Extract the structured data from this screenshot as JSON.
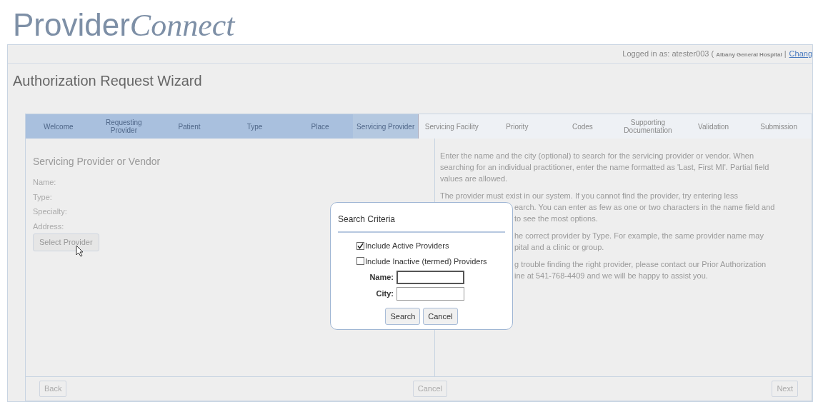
{
  "logo": {
    "part_1": "Provider",
    "part_2": "Connect"
  },
  "header": {
    "logged_in": "Logged in as: atester003 (",
    "organization": "Albany General Hospital",
    "separator": "|",
    "link": "Chang"
  },
  "page_title": "Authorization Request Wizard",
  "steps": [
    {
      "label": "Welcome",
      "completed": true,
      "selected": false
    },
    {
      "label": "Requesting Provider",
      "completed": true,
      "selected": false
    },
    {
      "label": "Patient",
      "completed": true,
      "selected": false
    },
    {
      "label": "Type",
      "completed": true,
      "selected": false
    },
    {
      "label": "Place",
      "completed": true,
      "selected": false
    },
    {
      "label": "Servicing Provider",
      "completed": false,
      "selected": true
    },
    {
      "label": "Servicing Facility",
      "completed": false,
      "selected": false
    },
    {
      "label": "Priority",
      "completed": false,
      "selected": false
    },
    {
      "label": "Codes",
      "completed": false,
      "selected": false
    },
    {
      "label": "Supporting Documentation",
      "completed": false,
      "selected": false
    },
    {
      "label": "Validation",
      "completed": false,
      "selected": false
    },
    {
      "label": "Submission",
      "completed": false,
      "selected": false
    }
  ],
  "left_pane": {
    "heading": "Servicing Provider or Vendor",
    "fields": [
      "Name:",
      "Type:",
      "Specialty:",
      "Address:"
    ],
    "button": "Select Provider"
  },
  "help_paragraphs": [
    {
      "lines": [
        {
          "text": "Enter the name and the city (optional) to search for the servicing provider or vendor. When",
          "covered": false
        },
        {
          "text": "searching for an individual practitioner, enter the name formatted as 'Last, First MI'. Partial field",
          "covered": false
        },
        {
          "text": "values are allowed.",
          "covered": false
        }
      ]
    },
    {
      "lines": [
        {
          "text": "The provider must exist in our system. If you cannot find the provider, try entering less",
          "covered": false
        },
        {
          "text": "earch.  You can enter as few as one or two characters in the name field and",
          "covered": true
        },
        {
          "text": "to see the most options.",
          "covered": true
        }
      ]
    },
    {
      "lines": [
        {
          "text": "he correct provider by Type.  For example, the same provider name may",
          "covered": true
        },
        {
          "text": "pital and a clinic or group.",
          "covered": true
        }
      ]
    },
    {
      "lines": [
        {
          "text": "g trouble finding the right provider, please contact our Prior Authorization",
          "covered": true
        },
        {
          "text": "ine at 541-768-4409 and we will be happy to assist you.",
          "covered": true
        }
      ]
    }
  ],
  "footer": {
    "back": "Back",
    "cancel": "Cancel",
    "next": "Next"
  },
  "dialog": {
    "title": "Search Criteria",
    "options": [
      {
        "label": "Include Active Providers",
        "checked": true
      },
      {
        "label": "Include Inactive (termed) Providers",
        "checked": false
      }
    ],
    "fields": [
      {
        "label": "Name:",
        "focused": true
      },
      {
        "label": "City:",
        "focused": false
      }
    ],
    "buttons": [
      "Search",
      "Cancel"
    ]
  }
}
